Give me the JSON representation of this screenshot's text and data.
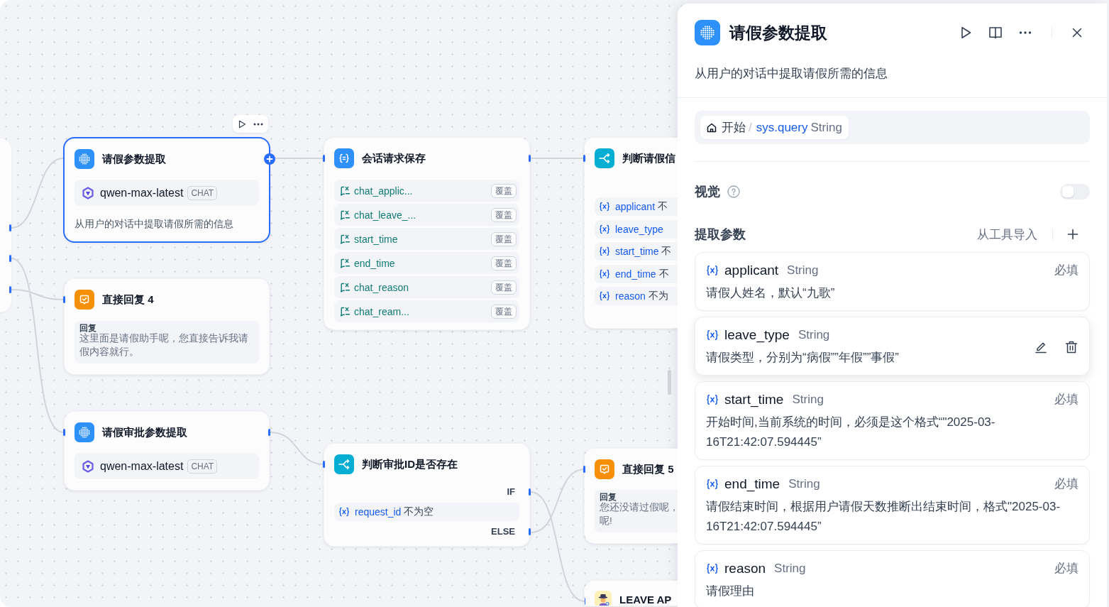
{
  "canvas": {
    "nodes": [
      {
        "kind": "llm",
        "title": "请假参数提取",
        "selected": true,
        "model": "qwen-max-latest",
        "mode": "CHAT",
        "description": "从用户的对话中提取请假所需的信息"
      },
      {
        "kind": "answer",
        "title": "直接回复 4",
        "selected": false,
        "reply_label": "回复",
        "reply_lines": [
          "这里面是请假助手呢，您直接告诉我请假内容就行。"
        ]
      },
      {
        "kind": "llm",
        "title": "请假审批参数提取",
        "selected": false,
        "model": "qwen-max-latest",
        "mode": "CHAT"
      },
      {
        "kind": "assigner",
        "title": "会话请求保存",
        "selected": false,
        "items": [
          {
            "variable": "chat_applic...",
            "mode": "覆盖"
          },
          {
            "variable": "chat_leave_...",
            "mode": "覆盖"
          },
          {
            "variable": "start_time",
            "mode": "覆盖"
          },
          {
            "variable": "end_time",
            "mode": "覆盖"
          },
          {
            "variable": "chat_reason",
            "mode": "覆盖"
          },
          {
            "variable": "chat_ream...",
            "mode": "覆盖"
          }
        ]
      },
      {
        "kind": "condition",
        "title": "判断请假信",
        "selected": false,
        "conditions": [
          {
            "variable": "applicant",
            "operator": "不"
          },
          {
            "variable": "leave_type"
          },
          {
            "variable": "start_time",
            "operator": "不"
          },
          {
            "variable": "end_time",
            "operator": "不"
          },
          {
            "variable": "reason",
            "operator": "不为"
          }
        ]
      },
      {
        "kind": "condition",
        "title": "判断审批ID是否存在",
        "selected": false,
        "if_label": "IF",
        "conditions": [
          {
            "variable": "request_id",
            "operator": "不为空"
          }
        ],
        "else_label": "ELSE"
      },
      {
        "kind": "answer",
        "title": "直接回复 5",
        "selected": false,
        "reply_label": "回复",
        "reply_lines": [
          "您还没请过假呢，",
          "呢!"
        ]
      },
      {
        "kind": "agent",
        "title": "LEAVE AP",
        "selected": false
      }
    ]
  },
  "panel": {
    "title": "请假参数提取",
    "description": "从用户的对话中提取请假所需的信息",
    "input_variable": {
      "source": "开始",
      "separator": "/",
      "variable": "sys.query",
      "type": "String"
    },
    "vision": {
      "label": "视觉",
      "on": false
    },
    "params_section": {
      "title": "提取参数",
      "import_label": "从工具导入"
    },
    "params": [
      {
        "name": "applicant",
        "type": "String",
        "required_label": "必填",
        "hovered": false,
        "description": "请假人姓名，默认“九歌”"
      },
      {
        "name": "leave_type",
        "type": "String",
        "hovered": true,
        "description": "请假类型，分别为“病假””年假””事假”"
      },
      {
        "name": "start_time",
        "type": "String",
        "required_label": "必填",
        "hovered": false,
        "description": "开始时间,当前系统的时间，必须是这个格式“\"2025-03-16T21:42:07.594445”"
      },
      {
        "name": "end_time",
        "type": "String",
        "required_label": "必填",
        "hovered": false,
        "description": "请假结束时间，根据用户请假天数推断出结束时间，格式\"2025-03-16T21:42:07.594445”"
      },
      {
        "name": "reason",
        "type": "String",
        "required_label": "必填",
        "hovered": false,
        "description": "请假理由"
      }
    ]
  }
}
